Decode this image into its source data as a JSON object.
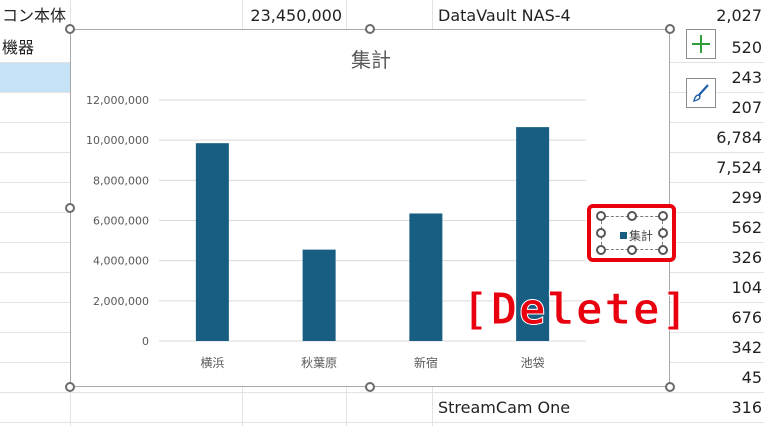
{
  "sheet": {
    "rows": [
      {
        "col_a": "コン本体",
        "col_b": "23,450,000",
        "col_c": "DataVault NAS-4",
        "col_d": "2,027"
      },
      {
        "col_a": "機器",
        "col_d": "520"
      },
      {
        "col_d": "243"
      },
      {
        "col_d": "207"
      },
      {
        "col_d": "6,784"
      },
      {
        "col_d": "7,524"
      },
      {
        "col_d": "299"
      },
      {
        "col_d": "562"
      },
      {
        "col_d": "326"
      },
      {
        "col_d": "104"
      },
      {
        "col_d": "676"
      },
      {
        "col_d": "342"
      },
      {
        "col_d": "45"
      },
      {
        "col_c": "StreamCam One",
        "col_d": "316"
      }
    ]
  },
  "chart_data": {
    "type": "bar",
    "title": "集計",
    "categories": [
      "横浜",
      "秋葉原",
      "新宿",
      "池袋"
    ],
    "series": [
      {
        "name": "集計",
        "values": [
          9850000,
          4550000,
          6350000,
          10650000
        ],
        "color": "#175e82"
      }
    ],
    "yticks": [
      "0",
      "2,000,000",
      "4,000,000",
      "6,000,000",
      "8,000,000",
      "10,000,000",
      "12,000,000"
    ],
    "ylim": [
      0,
      12000000
    ],
    "grid": true,
    "legend": "right"
  },
  "chart_tools": {
    "add_element_icon": "plus-icon",
    "style_icon": "paintbrush-icon"
  },
  "legend": {
    "label": "集計"
  },
  "annotation": {
    "text": "[Delete]",
    "color": "#e8000f"
  }
}
